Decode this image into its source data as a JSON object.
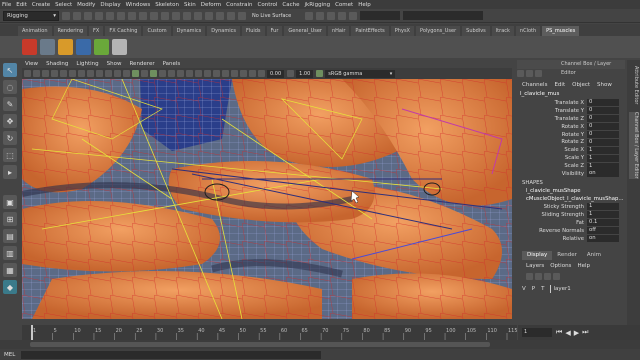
{
  "menubar": {
    "items": [
      "File",
      "Edit",
      "Create",
      "Select",
      "Modify",
      "Display",
      "Windows",
      "Skeleton",
      "Skin",
      "Deform",
      "Constrain",
      "Control",
      "Cache",
      "jkRigging",
      "Comet",
      "Help"
    ]
  },
  "statusline": {
    "menuset": "Rigging",
    "live_surface": "No Live Surface"
  },
  "shelf": {
    "tabs": [
      "Animation",
      "Rendering",
      "FX",
      "FX Caching",
      "Custom",
      "Dynamics",
      "Dynamics",
      "Fluids",
      "Fur",
      "General_User",
      "nHair",
      "PaintEffects",
      "PhysX",
      "Polygons_User",
      "Subdivs",
      "ltrack",
      "nCloth",
      "PS_muscles"
    ],
    "active_tab": "PS_muscles",
    "icon_colors": [
      "#c83a2a",
      "#6a7a8a",
      "#d89a2a",
      "#3a6aa8",
      "#6aa83a",
      "#b4b4b4",
      "#5a8aa8",
      "#a86a3a"
    ]
  },
  "viewport": {
    "menu": [
      "View",
      "Shading",
      "Lighting",
      "Show",
      "Renderer",
      "Panels"
    ],
    "value_a": "0.00",
    "value_b": "1.00",
    "color_space": "sRGB gamma"
  },
  "channel_box": {
    "header": "Channel Box / Layer Editor",
    "menu": [
      "Channels",
      "Edit",
      "Object",
      "Show"
    ],
    "object_name": "l_clavicle_mus",
    "channels": [
      {
        "label": "Translate X",
        "value": "0"
      },
      {
        "label": "Translate Y",
        "value": "0"
      },
      {
        "label": "Translate Z",
        "value": "0"
      },
      {
        "label": "Rotate X",
        "value": "0"
      },
      {
        "label": "Rotate Y",
        "value": "0"
      },
      {
        "label": "Rotate Z",
        "value": "0"
      },
      {
        "label": "Scale X",
        "value": "1"
      },
      {
        "label": "Scale Y",
        "value": "1"
      },
      {
        "label": "Scale Z",
        "value": "1"
      },
      {
        "label": "Visibility",
        "value": "on"
      }
    ],
    "shapes_label": "SHAPES",
    "shape_name": "l_clavicle_musShape",
    "shape_node": "cMuscleObject_l_clavicle_musShap...",
    "shape_attrs": [
      {
        "label": "Sticky Strength",
        "value": "1"
      },
      {
        "label": "Sliding Strength",
        "value": "1"
      },
      {
        "label": "Fat",
        "value": "0.1"
      },
      {
        "label": "Reverse Normals",
        "value": "off"
      },
      {
        "label": "Relative",
        "value": "on"
      }
    ]
  },
  "layer_editor": {
    "tabs": [
      "Display",
      "Render",
      "Anim"
    ],
    "active_tab": "Display",
    "menu": [
      "Layers",
      "Options",
      "Help"
    ],
    "layer": {
      "v": "V",
      "p": "P",
      "t": "T",
      "name": "layer1"
    }
  },
  "side_tabs": [
    "Attribute Editor",
    "Channel Box / Layer Editor"
  ],
  "timeslider": {
    "ticks": [
      "1",
      "5",
      "10",
      "15",
      "20",
      "25",
      "30",
      "35",
      "40",
      "45",
      "50",
      "55",
      "60",
      "65",
      "70",
      "75",
      "80",
      "85",
      "90",
      "95",
      "100",
      "105",
      "110",
      "115"
    ],
    "current_frame": "1"
  },
  "cmdline": {
    "label": "MEL"
  }
}
